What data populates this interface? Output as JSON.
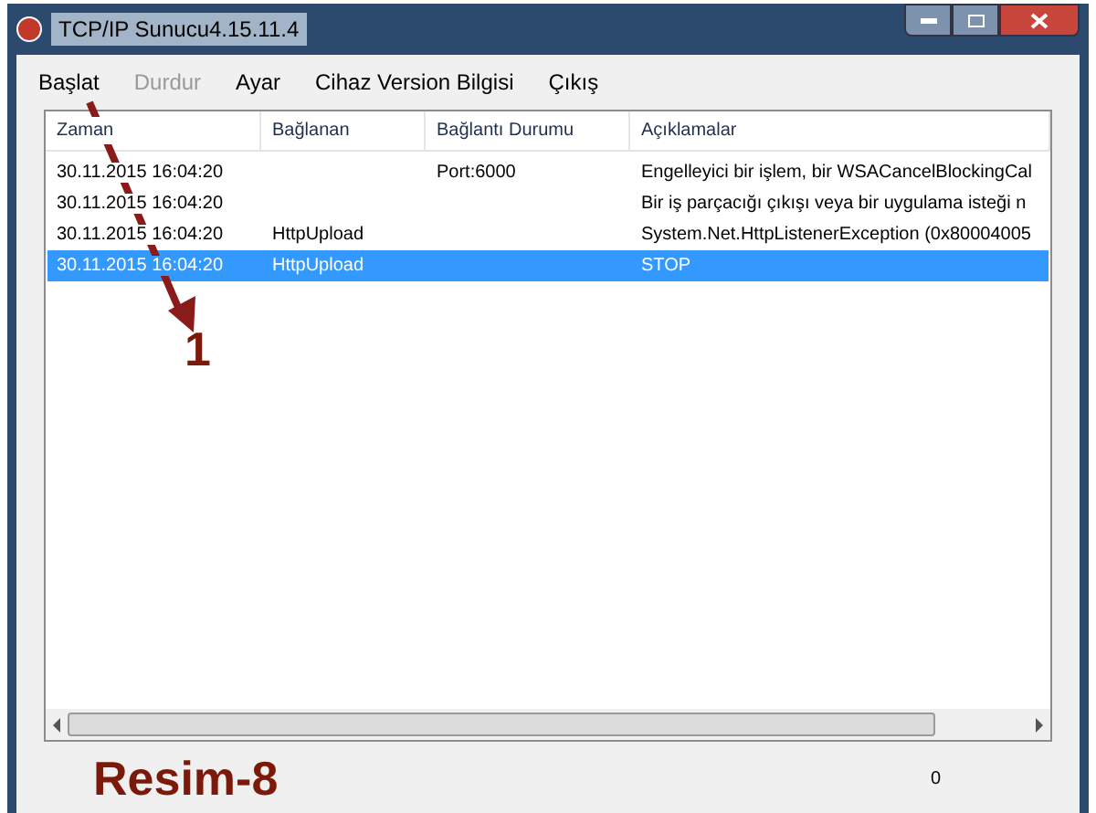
{
  "window": {
    "title": "TCP/IP Sunucu4.15.11.4"
  },
  "menu": [
    {
      "label": "Başlat",
      "disabled": false
    },
    {
      "label": "Durdur",
      "disabled": true
    },
    {
      "label": "Ayar",
      "disabled": false
    },
    {
      "label": "Cihaz Version Bilgisi",
      "disabled": false
    },
    {
      "label": "Çıkış",
      "disabled": false
    }
  ],
  "table": {
    "columns": [
      "Zaman",
      "Bağlanan",
      "Bağlantı Durumu",
      "Açıklamalar"
    ],
    "rows": [
      {
        "cells": [
          "30.11.2015 16:04:20",
          "",
          "Port:6000",
          "Engelleyici bir işlem, bir WSACancelBlockingCal"
        ],
        "selected": false
      },
      {
        "cells": [
          "30.11.2015 16:04:20",
          "",
          "",
          "Bir iş parçacığı çıkışı veya bir uygulama isteği n"
        ],
        "selected": false
      },
      {
        "cells": [
          "30.11.2015 16:04:20",
          "HttpUpload",
          "",
          "System.Net.HttpListenerException (0x80004005"
        ],
        "selected": false
      },
      {
        "cells": [
          "30.11.2015 16:04:20",
          "HttpUpload",
          "",
          "STOP"
        ],
        "selected": true
      }
    ]
  },
  "annotation": {
    "number": "1",
    "caption": "Resim-8"
  },
  "status_bar": {
    "count": "0"
  }
}
